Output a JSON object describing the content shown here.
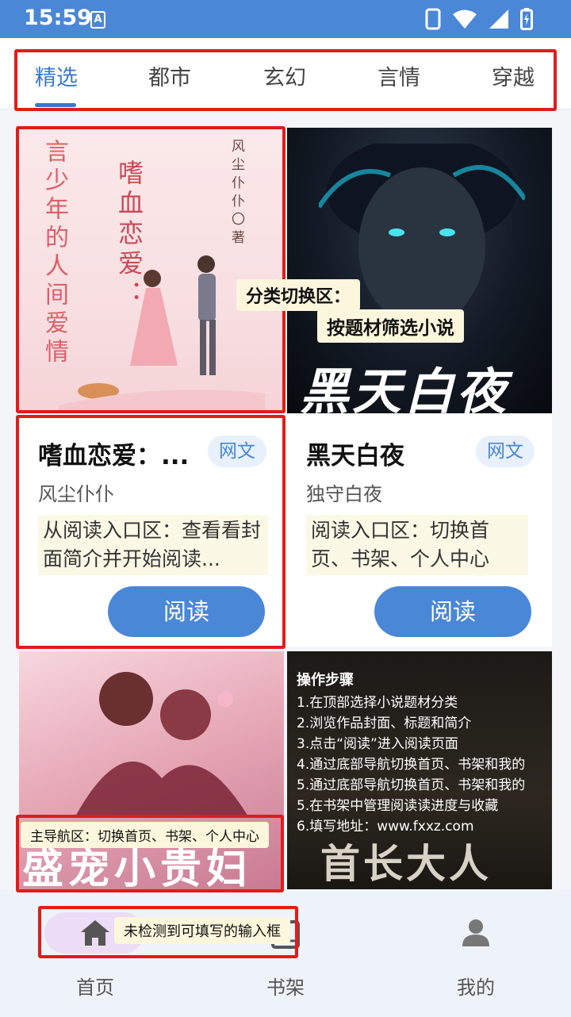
{
  "status_bar": {
    "time": "15:59",
    "notif_letter": "A"
  },
  "tabs": [
    {
      "label": "精选",
      "active": true
    },
    {
      "label": "都市",
      "active": false
    },
    {
      "label": "玄幻",
      "active": false
    },
    {
      "label": "言情",
      "active": false
    },
    {
      "label": "穿越",
      "active": false
    }
  ],
  "books": [
    {
      "title": "嗜血恋爱：...",
      "tag": "网文",
      "author": "风尘仆仆",
      "desc": "从阅读入口区：查看看封面简介并开始阅读...",
      "read_label": "阅读",
      "cover_lines": [
        "言少年的人间爱情",
        "嗜血恋爱：",
        "风尘仆仆〇著"
      ]
    },
    {
      "title": "黑天白夜",
      "tag": "网文",
      "author": "独守白夜",
      "desc": "阅读入口区：切换首页、书架、个人中心",
      "read_label": "阅读",
      "cover_lines": [
        "黑天白夜"
      ]
    },
    {
      "cover_lines": [
        "盛宠小贵妇"
      ]
    },
    {
      "cover_lines": [
        "首长大人"
      ]
    }
  ],
  "annotations": {
    "category_note_1": "分类切换区：",
    "category_note_2": "按题材筛选小说",
    "nav_note": "主导航区：切换首页、书架、个人中心",
    "input_note": "未检测到可填写的输入框"
  },
  "steps": {
    "title": "操作步骤",
    "items": [
      "1.在顶部选择小说题材分类",
      "2.浏览作品封面、标题和简介",
      "3.点击“阅读”进入阅读页面",
      "4.通过底部导航切换首页、书架和我的",
      "5.通过底部导航切换首页、书架和我的",
      "5.在书架中管理阅读读进度与收藏",
      "6.填写地址：www.fxxz.com"
    ]
  },
  "bottom_nav": [
    {
      "label": "首页",
      "icon": "home-icon",
      "active": true
    },
    {
      "label": "书架",
      "icon": "bookshelf-icon",
      "active": false
    },
    {
      "label": "我的",
      "icon": "profile-icon",
      "active": false
    }
  ],
  "colors": {
    "accent": "#4a87d6",
    "highlight": "#e21b1b",
    "tag_bg": "#e7f0fb"
  }
}
